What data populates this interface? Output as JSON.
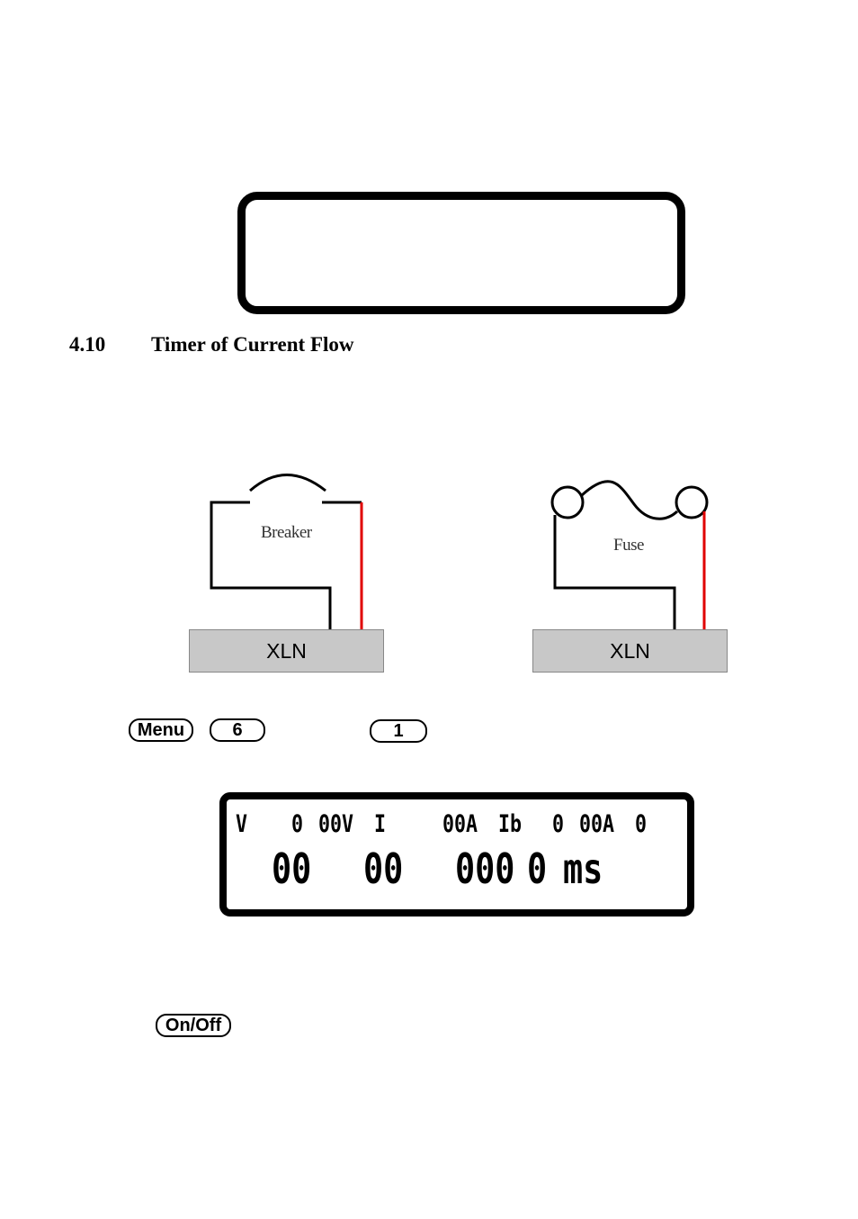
{
  "section": {
    "number": "4.10",
    "title": "Timer of Current Flow"
  },
  "diagrams": [
    {
      "label": "Breaker",
      "device": "XLN"
    },
    {
      "label": "Fuse",
      "device": "XLN"
    }
  ],
  "keys": {
    "menu": "Menu",
    "six": "6",
    "one": "1",
    "onoff": "On/Off"
  },
  "lcd": {
    "row1": [
      "V",
      "0",
      "00V",
      "I",
      "00A",
      "Ib",
      "0",
      "00A",
      "0"
    ],
    "row2": [
      "00",
      "00",
      "000",
      "0",
      "ms"
    ]
  },
  "colors": {
    "wire": "#000000",
    "red_wire": "#e00000",
    "device_fill": "#c8c8c8"
  }
}
